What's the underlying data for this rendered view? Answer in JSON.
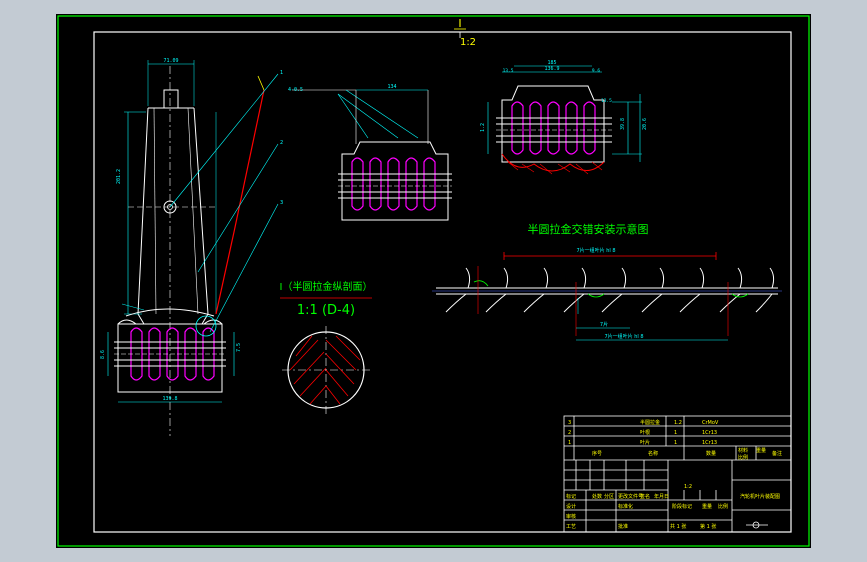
{
  "colors": {
    "background": "#c3cbd3",
    "sheet": "#000000",
    "frame_outer": "#00ff00",
    "frame_inner": "#ffffff",
    "cyan": "#00ffff",
    "magenta": "#ff00ff",
    "red": "#ff0000",
    "yellow": "#ffff00",
    "green": "#00ff00",
    "white": "#ffffff",
    "blue": "#4f6cff"
  },
  "drawing": {
    "top_label": "I",
    "top_scale": "1:2",
    "section_title": "I（半圆拉金纵剖面）",
    "section_scale": "1:1 (D-4)",
    "install_title": "半圆拉金交错安装示意图",
    "install_note_top": "7片一组叶片 hl 8",
    "install_note_mid": "7片",
    "install_note_bottom": "7片一组叶片 hl 8",
    "balloons": [
      "1",
      "2",
      "3",
      "4"
    ],
    "small_dims": [
      "71.09",
      "201.2",
      "139.8",
      "8.6",
      "7.5",
      "134",
      "185",
      "136.9",
      "13.5",
      "9.6",
      "1.2",
      "39.8",
      "20.6",
      "4-0.5"
    ]
  },
  "title_block": {
    "rows_top": [
      {
        "num": "3",
        "name": "半圆拉金",
        "qty": "1.2",
        "mat": "CrMoV",
        "note": ""
      },
      {
        "num": "2",
        "name": "叶根",
        "qty": "1",
        "mat": "1Cr13",
        "note": ""
      },
      {
        "num": "1",
        "name": "叶片",
        "qty": "1",
        "mat": "1Cr13",
        "note": ""
      }
    ],
    "header": {
      "num": "序号",
      "name": "名称",
      "qty": "数量",
      "mat": "材料",
      "weight": "重量",
      "scale": "比例",
      "remark": "备注"
    },
    "labels": [
      "标记",
      "处数",
      "分区",
      "更改文件号",
      "签名",
      "年月日",
      "设计",
      "标准化",
      "阶段标记",
      "重量",
      "比例",
      "审核",
      "工艺",
      "批准",
      "共 1 张",
      "第 1 张"
    ],
    "drawing_name": "汽轮机叶片装配图",
    "scale": "1:2"
  }
}
